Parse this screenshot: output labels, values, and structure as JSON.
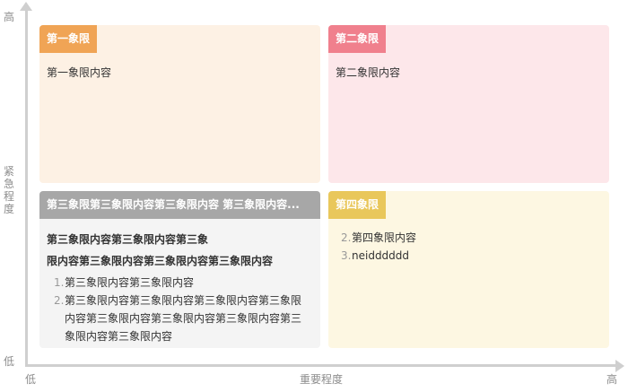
{
  "axes": {
    "y_high": "高",
    "y_low": "低",
    "y_title": "紧急程度",
    "x_low": "低",
    "x_high": "高",
    "x_title": "重要程度"
  },
  "quadrants": {
    "q1": {
      "title": "第一象限",
      "text": "第一象限内容",
      "color": "#f0a455",
      "bg": "#fdf1e4"
    },
    "q2": {
      "title": "第二象限",
      "text": "第二象限内容",
      "color": "#f0808d",
      "bg": "#fde7ea"
    },
    "q3": {
      "title": "第三象限第三象限内容第三象限内容 第三象限内容...",
      "bold_line_1": "第三象限内容第三象限内容第三象",
      "bold_line_2": "限内容第三象限内容第三象限内容第三象限内容",
      "items": [
        {
          "num": "1.",
          "text": "第三象限内容第三象限内容"
        },
        {
          "num": "2.",
          "text": "第三象限内容第三象限内容第三象限内容第三象限内容第三象限内容第三象限内容第三象限内容第三象限内容第三象限内容"
        }
      ],
      "color": "#a7a7a7",
      "bg": "#f4f4f4"
    },
    "q4": {
      "title": "第四象限",
      "items": [
        {
          "num": "2.",
          "text": "第四象限内容"
        },
        {
          "num": "3.",
          "text": "neidddddd"
        }
      ],
      "color": "#e9c75b",
      "bg": "#fdf7e2"
    }
  }
}
